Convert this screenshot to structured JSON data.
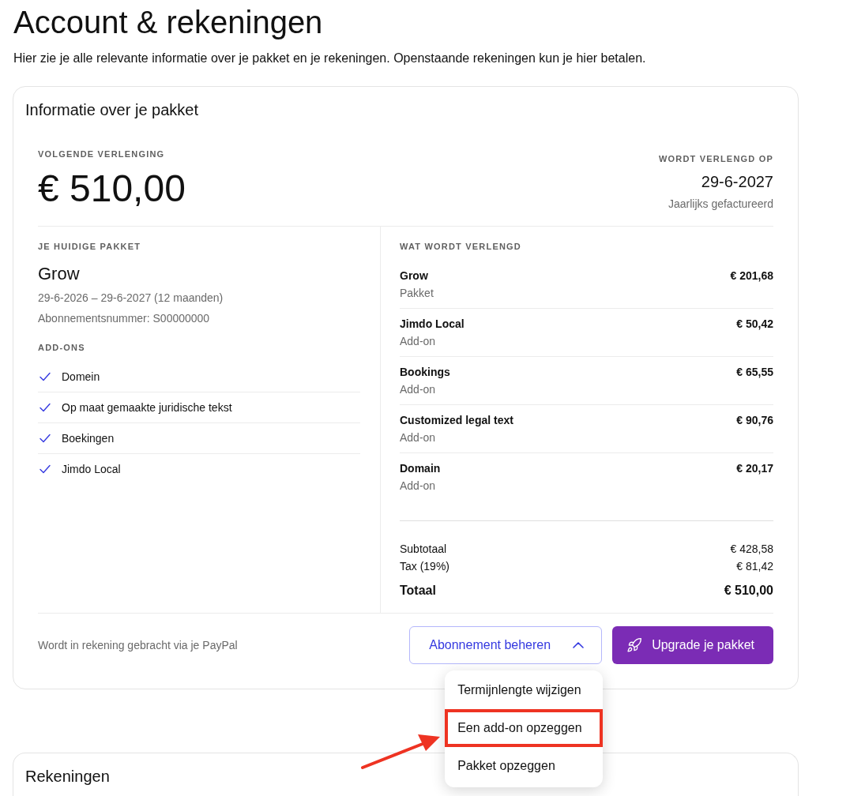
{
  "page": {
    "title": "Account & rekeningen",
    "intro": "Hier zie je alle relevante informatie over je pakket en je rekeningen. Openstaande rekeningen kun je hier betalen."
  },
  "package_card": {
    "title": "Informatie over je pakket",
    "next_renewal": {
      "label": "VOLGENDE VERLENGING",
      "amount": "€ 510,00"
    },
    "renewal_date": {
      "label": "WORDT VERLENGD OP",
      "date": "29-6-2027",
      "billing": "Jaarlijks gefactureerd"
    },
    "current_package": {
      "label": "JE HUIDIGE PAKKET",
      "name": "Grow",
      "period": "29-6-2026 – 29-6-2027 (12 maanden)",
      "subscription_number": "Abonnementsnummer: S00000000",
      "addons_label": "ADD-ONS",
      "addons": [
        {
          "name": "Domein",
          "checked": true
        },
        {
          "name": "Op maat gemaakte juridische tekst",
          "checked": true
        },
        {
          "name": "Boekingen",
          "checked": true
        },
        {
          "name": "Jimdo Local",
          "checked": true
        }
      ]
    },
    "renewal_items": {
      "label": "WAT WORDT VERLENGD",
      "items": [
        {
          "name": "Grow",
          "type_label": "Pakket",
          "price": "€ 201,68"
        },
        {
          "name": "Jimdo Local",
          "type_label": "Add-on",
          "price": "€ 50,42"
        },
        {
          "name": "Bookings",
          "type_label": "Add-on",
          "price": "€ 65,55"
        },
        {
          "name": "Customized legal text",
          "type_label": "Add-on",
          "price": "€ 90,76"
        },
        {
          "name": "Domain",
          "type_label": "Add-on",
          "price": "€ 20,17"
        }
      ],
      "subtotal": {
        "label": "Subtotaal",
        "value": "€ 428,58"
      },
      "tax": {
        "label": "Tax (19%)",
        "value": "€ 81,42"
      },
      "total": {
        "label": "Totaal",
        "value": "€ 510,00"
      }
    },
    "payment_note": "Wordt in rekening gebracht via je PayPal",
    "manage_button": {
      "label": "Abonnement beheren",
      "expanded": true
    },
    "upgrade_button": {
      "label": "Upgrade je pakket"
    },
    "menu": [
      {
        "label": "Termijnlengte wijzigen",
        "highlighted": false
      },
      {
        "label": "Een add-on opzeggen",
        "highlighted": true
      },
      {
        "label": "Pakket opzeggen",
        "highlighted": false
      }
    ]
  },
  "invoices_card": {
    "title": "Rekeningen"
  }
}
